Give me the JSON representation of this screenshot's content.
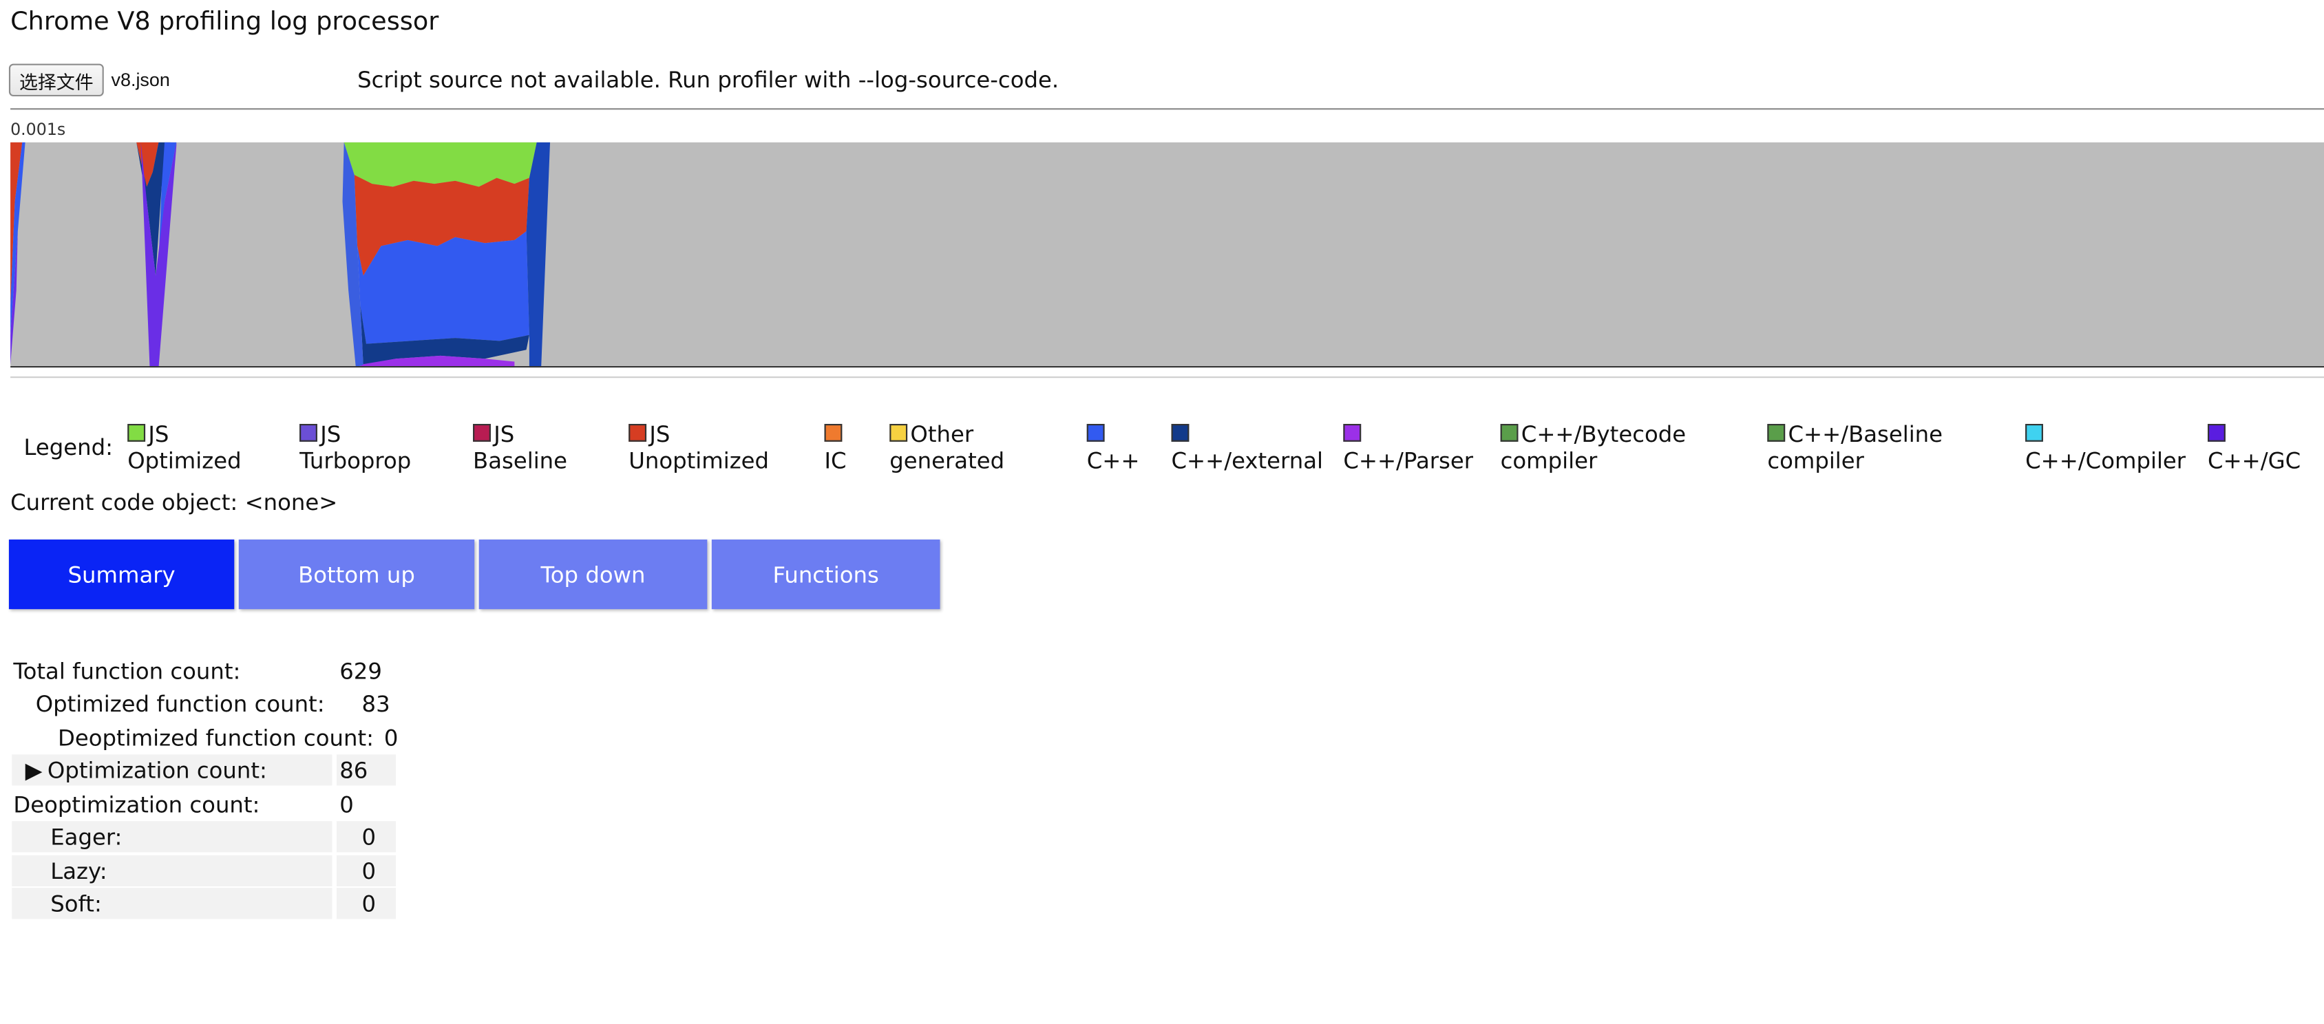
{
  "title": "Chrome V8 profiling log processor",
  "file": {
    "button_label": "选择文件",
    "file_name": "v8.json"
  },
  "script_message": "Script source not available. Run profiler with --log-source-code.",
  "timeline": {
    "scale_label": "0.001s"
  },
  "legend": {
    "label": "Legend:",
    "items": [
      {
        "label": "JS\nOptimized",
        "color": "#82dc44"
      },
      {
        "label": "JS\nTurboprop",
        "color": "#6b4fd6"
      },
      {
        "label": "JS\nBaseline",
        "color": "#b81c52"
      },
      {
        "label": "JS\nUnoptimized",
        "color": "#d63d22"
      },
      {
        "label": "\nIC",
        "color": "#ef7a2e"
      },
      {
        "label": "Other\ngenerated",
        "color": "#f6d141"
      },
      {
        "label": "\nC++",
        "color": "#325af0"
      },
      {
        "label": "\nC++/external",
        "color": "#123a8a"
      },
      {
        "label": "\nC++/Parser",
        "color": "#9b30e8"
      },
      {
        "label": "C++/Bytecode\ncompiler",
        "color": "#5a9e4a"
      },
      {
        "label": "C++/Baseline\ncompiler",
        "color": "#5a9e4a"
      },
      {
        "label": "\nC++/Compiler",
        "color": "#3fd2f0"
      },
      {
        "label": "\nC++/GC",
        "color": "#5a1de0"
      }
    ]
  },
  "current_code": "Current code object: <none>",
  "tabs": [
    {
      "label": "Summary",
      "active": true
    },
    {
      "label": "Bottom up",
      "active": false
    },
    {
      "label": "Top down",
      "active": false
    },
    {
      "label": "Functions",
      "active": false
    }
  ],
  "summary": {
    "total_function_count_label": "Total function count:",
    "total_function_count": "629",
    "optimized_function_count_label": "Optimized function count:",
    "optimized_function_count": "83",
    "deoptimized_function_count_label": "Deoptimized function count:",
    "deoptimized_function_count": "0",
    "optimization_count_label": "Optimization count:",
    "optimization_count": "86",
    "deoptimization_count_label": "Deoptimization count:",
    "deoptimization_count": "0",
    "eager_label": "Eager:",
    "eager": "0",
    "lazy_label": "Lazy:",
    "lazy": "0",
    "soft_label": "Soft:",
    "soft": "0"
  },
  "colors": {
    "timeline_background": "#bcbcbc",
    "tab_active": "#0a24f5",
    "tab_inactive": "#6c7df2"
  }
}
